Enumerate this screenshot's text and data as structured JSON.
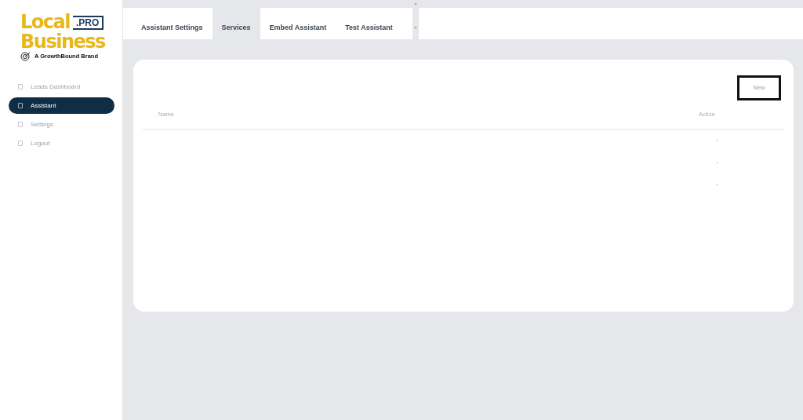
{
  "logo": {
    "line_1": "Local",
    "badge": ".PRO",
    "line_2": "Business",
    "tagline": "A GrowthBound Brand"
  },
  "sidebar": {
    "items": [
      {
        "label": "Leads Dashboard",
        "selected": false
      },
      {
        "label": "Assistant",
        "selected": true
      },
      {
        "label": "Settings",
        "selected": false
      },
      {
        "label": "Logout",
        "selected": false
      }
    ]
  },
  "tabs": [
    {
      "label": "Assistant Settings",
      "selected": false
    },
    {
      "label": "Services",
      "selected": true
    },
    {
      "label": "Embed Assistant",
      "selected": false
    },
    {
      "label": "Test Assistant",
      "selected": false
    }
  ],
  "new_button": "New",
  "table": {
    "columns": [
      "Name",
      "Action"
    ],
    "rows": [
      {
        "action": "-"
      },
      {
        "action": "-"
      },
      {
        "action": "-"
      }
    ]
  }
}
